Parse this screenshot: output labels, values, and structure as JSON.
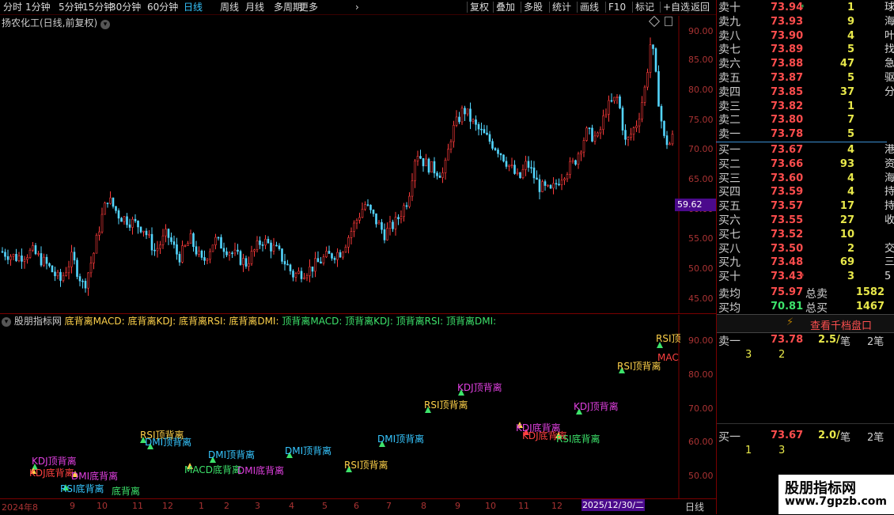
{
  "toolbar": {
    "left": [
      "分时",
      "1分钟",
      "5分钟",
      "15分钟",
      "30分钟",
      "60分钟",
      "日线",
      "周线",
      "月线",
      "多周期",
      "更多"
    ],
    "active": "日线",
    "right": [
      "复权",
      "叠加",
      "多股",
      "统计",
      "画线",
      "F10",
      "标记",
      "+自选",
      "返回"
    ]
  },
  "main_chart": {
    "title": "扬农化工(日线,前复权)",
    "y_ticks": [
      "90.00",
      "85.00",
      "80.00",
      "75.00",
      "70.00",
      "65.00",
      "60.00",
      "55.00",
      "50.00",
      "45.00"
    ],
    "current_price": "59.62"
  },
  "indicator": {
    "title_parts": [
      {
        "text": "股朋指标网 ",
        "color": "#cccccc"
      },
      {
        "text": "底背离MACD: 底背离KDJ: 底背离RSI: 底背离DMI: ",
        "color": "#ffd24a"
      },
      {
        "text": "顶背离MACD: 顶背离KDJ: 顶背离RSI: 顶背离DMI:",
        "color": "#3de36b"
      }
    ],
    "y_ticks": [
      "90.00",
      "80.00",
      "70.00",
      "60.00",
      "50.00"
    ],
    "labels": [
      {
        "t": "RSI顶",
        "x": 829,
        "y": 432,
        "c": "#ffd24a"
      },
      {
        "t": "MAC",
        "x": 831,
        "y": 456,
        "c": "#ff4040"
      },
      {
        "t": "RSI顶背离",
        "x": 780,
        "y": 467,
        "c": "#ffd24a"
      },
      {
        "t": "KDJ顶背离",
        "x": 578,
        "y": 494,
        "c": "#e040e0"
      },
      {
        "t": "KDJ顶背离",
        "x": 725,
        "y": 518,
        "c": "#e040e0"
      },
      {
        "t": "RSI顶背离",
        "x": 536,
        "y": 516,
        "c": "#ffd24a"
      },
      {
        "t": "KDJ底背离",
        "x": 652,
        "y": 545,
        "c": "#e040e0"
      },
      {
        "t": "KDJ底背离",
        "x": 660,
        "y": 555,
        "c": "#ff4040"
      },
      {
        "t": "RSI底背离",
        "x": 703,
        "y": 559,
        "c": "#3de36b"
      },
      {
        "t": "DMI顶背离",
        "x": 477,
        "y": 559,
        "c": "#36c6ff"
      },
      {
        "t": "RSI顶背离",
        "x": 177,
        "y": 554,
        "c": "#ffd24a"
      },
      {
        "t": "DMI顶背离",
        "x": 183,
        "y": 563,
        "c": "#36c6ff"
      },
      {
        "t": "DMI顶背离",
        "x": 263,
        "y": 579,
        "c": "#36c6ff"
      },
      {
        "t": "DMI顶背离",
        "x": 360,
        "y": 574,
        "c": "#36c6ff"
      },
      {
        "t": "KDJ顶背离",
        "x": 40,
        "y": 587,
        "c": "#e040e0"
      },
      {
        "t": "RSI顶背离",
        "x": 435,
        "y": 592,
        "c": "#ffd24a"
      },
      {
        "t": "MACD底背离",
        "x": 233,
        "y": 598,
        "c": "#3de36b"
      },
      {
        "t": "DMI底背离",
        "x": 300,
        "y": 599,
        "c": "#e040e0"
      },
      {
        "t": "KDJ底背离",
        "x": 37,
        "y": 602,
        "c": "#ff4040"
      },
      {
        "t": "DMI底背离",
        "x": 90,
        "y": 606,
        "c": "#e040e0"
      },
      {
        "t": "RSI底背离",
        "x": 76,
        "y": 622,
        "c": "#36c6ff"
      },
      {
        "t": "底背离",
        "x": 141,
        "y": 625,
        "c": "#3de36b"
      }
    ],
    "markers": [
      {
        "x": 834,
        "y": 437,
        "c": "#3de36b"
      },
      {
        "x": 786,
        "y": 469,
        "c": "#3de36b"
      },
      {
        "x": 583,
        "y": 497,
        "c": "#3de36b"
      },
      {
        "x": 732,
        "y": 521,
        "c": "#3de36b"
      },
      {
        "x": 541,
        "y": 519,
        "c": "#3de36b"
      },
      {
        "x": 657,
        "y": 538,
        "c": "#ffd24a"
      },
      {
        "x": 665,
        "y": 547,
        "c": "#ff4040"
      },
      {
        "x": 706,
        "y": 551,
        "c": "#ffd24a"
      },
      {
        "x": 483,
        "y": 562,
        "c": "#3de36b"
      },
      {
        "x": 181,
        "y": 557,
        "c": "#3de36b"
      },
      {
        "x": 190,
        "y": 565,
        "c": "#3de36b"
      },
      {
        "x": 269,
        "y": 582,
        "c": "#3de36b"
      },
      {
        "x": 366,
        "y": 576,
        "c": "#3de36b"
      },
      {
        "x": 44,
        "y": 591,
        "c": "#3de36b"
      },
      {
        "x": 441,
        "y": 594,
        "c": "#3de36b"
      },
      {
        "x": 240,
        "y": 590,
        "c": "#ffd24a"
      },
      {
        "x": 42,
        "y": 596,
        "c": "#ffd24a"
      },
      {
        "x": 95,
        "y": 600,
        "c": "#ffd24a"
      },
      {
        "x": 83,
        "y": 617,
        "c": "#3de36b"
      }
    ]
  },
  "dates": [
    {
      "t": "2024年8",
      "x": 2
    },
    {
      "t": "9",
      "x": 88
    },
    {
      "t": "10",
      "x": 122
    },
    {
      "t": "11",
      "x": 167
    },
    {
      "t": "12",
      "x": 205
    },
    {
      "t": "1",
      "x": 251
    },
    {
      "t": "2",
      "x": 283
    },
    {
      "t": "3",
      "x": 322
    },
    {
      "t": "4",
      "x": 365
    },
    {
      "t": "5",
      "x": 407
    },
    {
      "t": "6",
      "x": 447
    },
    {
      "t": "7",
      "x": 488
    },
    {
      "t": "8",
      "x": 532
    },
    {
      "t": "9",
      "x": 575
    },
    {
      "t": "10",
      "x": 613
    },
    {
      "t": "11",
      "x": 655
    },
    {
      "t": "12",
      "x": 697
    }
  ],
  "date_highlight": "2025/12/30/二",
  "period_label": "日线",
  "order_book": {
    "sell": [
      {
        "label": "卖十",
        "price": "73.94",
        "vol": "1",
        "cut": "球"
      },
      {
        "label": "卖九",
        "price": "73.93",
        "vol": "9",
        "cut": "海"
      },
      {
        "label": "卖八",
        "price": "73.90",
        "vol": "4",
        "cut": "叶"
      },
      {
        "label": "卖七",
        "price": "73.89",
        "vol": "5",
        "cut": "找"
      },
      {
        "label": "卖六",
        "price": "73.88",
        "vol": "47",
        "cut": "急"
      },
      {
        "label": "卖五",
        "price": "73.87",
        "vol": "5",
        "cut": "驱"
      },
      {
        "label": "卖四",
        "price": "73.85",
        "vol": "37",
        "cut": "分"
      },
      {
        "label": "卖三",
        "price": "73.82",
        "vol": "1",
        "cut": ""
      },
      {
        "label": "卖二",
        "price": "73.80",
        "vol": "7",
        "cut": ""
      },
      {
        "label": "卖一",
        "price": "73.78",
        "vol": "5",
        "cut": ""
      }
    ],
    "buy": [
      {
        "label": "买一",
        "price": "73.67",
        "vol": "4",
        "cut": "港"
      },
      {
        "label": "买二",
        "price": "73.66",
        "vol": "93",
        "cut": "资"
      },
      {
        "label": "买三",
        "price": "73.60",
        "vol": "4",
        "cut": "海"
      },
      {
        "label": "买四",
        "price": "73.59",
        "vol": "4",
        "cut": "持"
      },
      {
        "label": "买五",
        "price": "73.57",
        "vol": "17",
        "cut": "持"
      },
      {
        "label": "买六",
        "price": "73.55",
        "vol": "27",
        "cut": "收"
      },
      {
        "label": "买七",
        "price": "73.52",
        "vol": "10",
        "cut": ""
      },
      {
        "label": "买八",
        "price": "73.50",
        "vol": "2",
        "cut": "交"
      },
      {
        "label": "买九",
        "price": "73.48",
        "vol": "69",
        "cut": "三"
      },
      {
        "label": "买十",
        "price": "73.43",
        "vol": "3",
        "cut": "5"
      }
    ],
    "summary": {
      "sell_avg_label": "卖均",
      "sell_avg": "75.97",
      "sell_total_label": "总卖",
      "sell_total": "1582",
      "buy_avg_label": "买均",
      "buy_avg": "70.81",
      "buy_total_label": "总买",
      "buy_total": "1467"
    },
    "detail_button": "查看千档盘口",
    "queue": {
      "sell": {
        "label": "卖一",
        "price": "73.78",
        "amount": "2.5/",
        "unit": "笔",
        "count": "2笔",
        "orders": [
          "3",
          "2"
        ]
      },
      "buy": {
        "label": "买一",
        "price": "73.67",
        "amount": "2.0/",
        "unit": "笔",
        "count": "2笔",
        "orders": [
          "1",
          "3"
        ]
      }
    }
  },
  "watermark": {
    "line1": "股朋指标网",
    "line2": "www.7gpzb.com"
  }
}
